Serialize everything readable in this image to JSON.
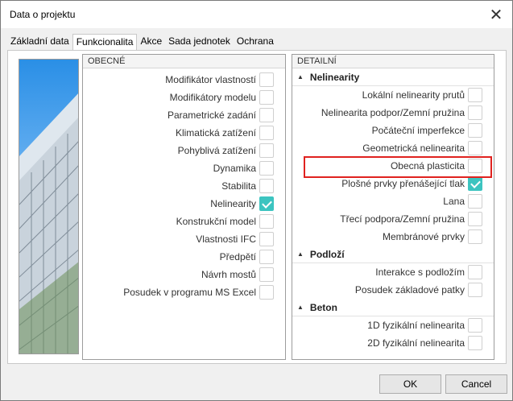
{
  "window": {
    "title": "Data o projektu",
    "close_glyph": "✕"
  },
  "tabs": [
    "Základní data",
    "Funkcionalita",
    "Akce",
    "Sada jednotek",
    "Ochrana"
  ],
  "active_tab": "Funkcionalita",
  "general": {
    "header": "OBECNÉ",
    "items": [
      {
        "label": "Modifikátor vlastností",
        "checked": false
      },
      {
        "label": "Modifikátory modelu",
        "checked": false
      },
      {
        "label": "Parametrické zadání",
        "checked": false
      },
      {
        "label": "Klimatická zatížení",
        "checked": false
      },
      {
        "label": "Pohyblivá zatížení",
        "checked": false
      },
      {
        "label": "Dynamika",
        "checked": false
      },
      {
        "label": "Stabilita",
        "checked": false
      },
      {
        "label": "Nelinearity",
        "checked": true
      },
      {
        "label": "Konstrukční model",
        "checked": false
      },
      {
        "label": "Vlastnosti IFC",
        "checked": false
      },
      {
        "label": "Předpětí",
        "checked": false
      },
      {
        "label": "Návrh mostů",
        "checked": false
      },
      {
        "label": "Posudek v programu MS Excel",
        "checked": false
      }
    ]
  },
  "detail": {
    "header": "DETAILNÍ",
    "sections": [
      {
        "title": "Nelinearity",
        "items": [
          {
            "label": "Lokální nelinearity prutů",
            "checked": false
          },
          {
            "label": "Nelinearita podpor/Zemní pružina",
            "checked": false
          },
          {
            "label": "Počáteční imperfekce",
            "checked": false
          },
          {
            "label": "Geometrická nelinearita",
            "checked": false
          },
          {
            "label": "Obecná plasticita",
            "checked": false
          },
          {
            "label": "Plošné prvky přenášející tlak",
            "checked": true
          },
          {
            "label": "Lana",
            "checked": false
          },
          {
            "label": "Třecí podpora/Zemní pružina",
            "checked": false
          },
          {
            "label": "Membránové prvky",
            "checked": false
          }
        ]
      },
      {
        "title": "Podloží",
        "items": [
          {
            "label": "Interakce s podložím",
            "checked": false
          },
          {
            "label": "Posudek základové patky",
            "checked": false
          }
        ]
      },
      {
        "title": "Beton",
        "items": [
          {
            "label": "1D fyzikální nelinearita",
            "checked": false
          },
          {
            "label": "2D fyzikální nelinearita",
            "checked": false
          }
        ]
      }
    ]
  },
  "buttons": {
    "ok": "OK",
    "cancel": "Cancel"
  },
  "colors": {
    "checked_accent": "#3cc4c0",
    "highlight_border": "#e0221f"
  }
}
